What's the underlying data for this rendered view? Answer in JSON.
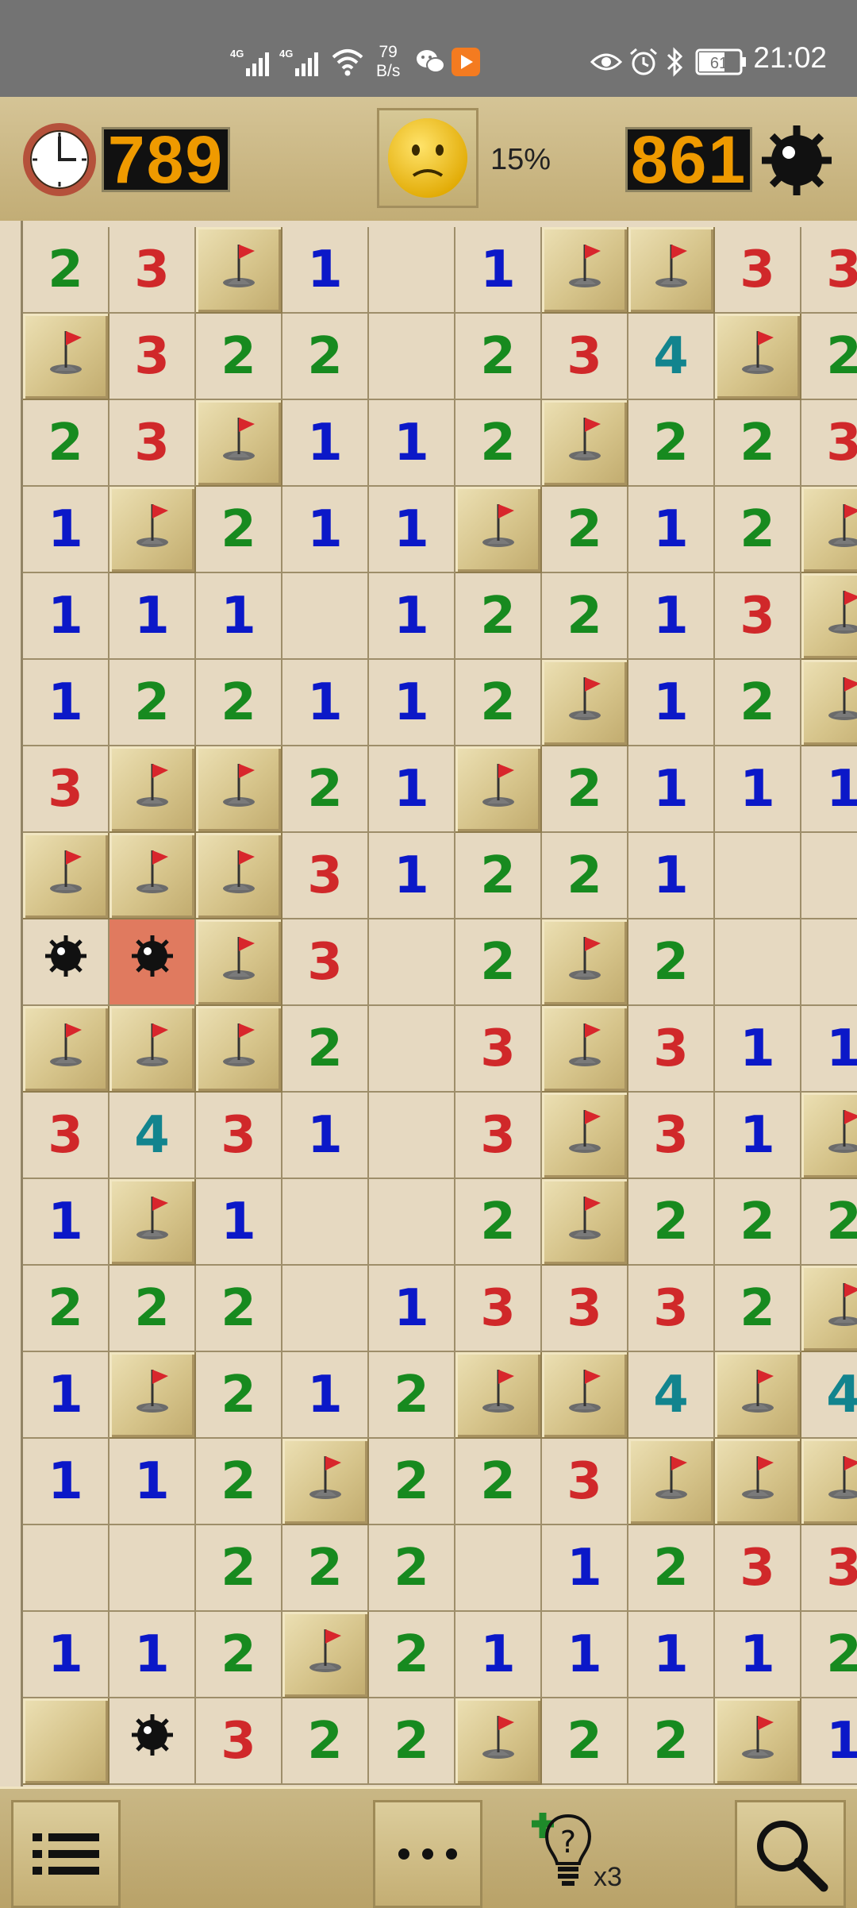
{
  "status_bar": {
    "time": "21:02",
    "net_speed_value": "79",
    "net_speed_unit": "B/s",
    "battery_level": "61",
    "icons": [
      "signal-4g-icon",
      "signal-4g-icon",
      "wifi-icon",
      "wechat-icon",
      "video-app-icon",
      "eye-icon",
      "alarm-icon",
      "bluetooth-icon",
      "battery-icon"
    ]
  },
  "header": {
    "timer": "789",
    "face": "worried-face-icon",
    "progress_percent": "15%",
    "mines_remaining": "861"
  },
  "colors": {
    "n1": "#0b18c8",
    "n2": "#178a1f",
    "n3": "#d0282a",
    "n4": "#12848e",
    "exploded": "#e07a5f",
    "counter_digits": "#ef9a00"
  },
  "board": {
    "legend": {
      "F": "flag",
      "M": "mine",
      "X": "exploded-mine",
      "C": "covered",
      "0": "empty-revealed",
      "1-8": "number"
    },
    "rows": [
      [
        "2",
        "3",
        "F",
        "1",
        "0",
        "1",
        "F",
        "F",
        "3",
        "3"
      ],
      [
        "F",
        "3",
        "2",
        "2",
        "0",
        "2",
        "3",
        "4",
        "F",
        "2"
      ],
      [
        "2",
        "3",
        "F",
        "1",
        "1",
        "2",
        "F",
        "2",
        "2",
        "3"
      ],
      [
        "1",
        "F",
        "2",
        "1",
        "1",
        "F",
        "2",
        "1",
        "2",
        "F"
      ],
      [
        "1",
        "1",
        "1",
        "0",
        "1",
        "2",
        "2",
        "1",
        "3",
        "F"
      ],
      [
        "1",
        "2",
        "2",
        "1",
        "1",
        "2",
        "F",
        "1",
        "2",
        "F"
      ],
      [
        "3",
        "F",
        "F",
        "2",
        "1",
        "F",
        "2",
        "1",
        "1",
        "1"
      ],
      [
        "F",
        "F",
        "F",
        "3",
        "1",
        "2",
        "2",
        "1",
        "0",
        "0"
      ],
      [
        "M",
        "X",
        "F",
        "3",
        "0",
        "2",
        "F",
        "2",
        "0",
        "0"
      ],
      [
        "F",
        "F",
        "F",
        "2",
        "0",
        "3",
        "F",
        "3",
        "1",
        "1"
      ],
      [
        "3",
        "4",
        "3",
        "1",
        "0",
        "3",
        "F",
        "3",
        "1",
        "F"
      ],
      [
        "1",
        "F",
        "1",
        "0",
        "0",
        "2",
        "F",
        "2",
        "2",
        "2"
      ],
      [
        "2",
        "2",
        "2",
        "0",
        "1",
        "3",
        "3",
        "3",
        "2",
        "F"
      ],
      [
        "1",
        "F",
        "2",
        "1",
        "2",
        "F",
        "F",
        "4",
        "F",
        "4"
      ],
      [
        "1",
        "1",
        "2",
        "F",
        "2",
        "2",
        "3",
        "F",
        "F",
        "F"
      ],
      [
        "0",
        "0",
        "2",
        "2",
        "2",
        "0",
        "1",
        "2",
        "3",
        "3"
      ],
      [
        "1",
        "1",
        "2",
        "F",
        "2",
        "1",
        "1",
        "1",
        "1",
        "2"
      ],
      [
        "C",
        "M",
        "3",
        "2",
        "2",
        "F",
        "2",
        "2",
        "F",
        "1"
      ]
    ]
  },
  "bottom_bar": {
    "menu": "list-icon",
    "more": "more-dots-icon",
    "hint": "lightbulb-hint-icon",
    "hint_count": "x3",
    "zoom": "magnifier-icon"
  }
}
